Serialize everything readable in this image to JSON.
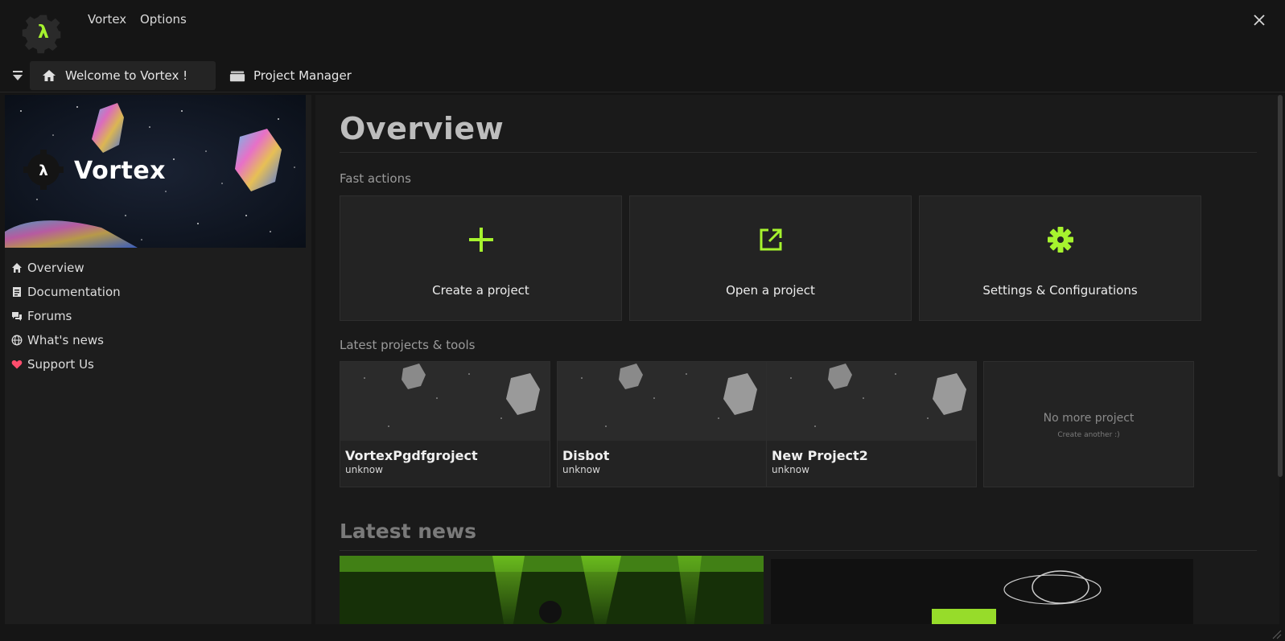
{
  "app": {
    "menu": [
      "Vortex",
      "Options"
    ],
    "logo_icon": "lambda-gear-icon",
    "accent": "#a6f32e"
  },
  "tabs": [
    {
      "label": "Welcome to Vortex !",
      "icon": "home-icon",
      "active": true
    },
    {
      "label": "Project Manager",
      "icon": "stack-icon",
      "active": false
    }
  ],
  "sidebar": {
    "banner_title": "Vortex",
    "items": [
      {
        "label": "Overview",
        "icon": "home-icon"
      },
      {
        "label": "Documentation",
        "icon": "document-icon"
      },
      {
        "label": "Forums",
        "icon": "chat-icon"
      },
      {
        "label": "What's news",
        "icon": "globe-icon"
      },
      {
        "label": "Support Us",
        "icon": "heart-icon",
        "icon_color": "#ff4d6d"
      }
    ]
  },
  "main": {
    "title": "Overview",
    "fast_actions_label": "Fast actions",
    "fast_actions": [
      {
        "label": "Create a project",
        "icon": "plus-icon"
      },
      {
        "label": "Open a project",
        "icon": "external-link-icon"
      },
      {
        "label": "Settings & Configurations",
        "icon": "gear-icon"
      }
    ],
    "latest_label": "Latest projects & tools",
    "projects": [
      {
        "name": "VortexPgdfgroject",
        "author": "unknow"
      },
      {
        "name": "Disbot",
        "author": "unknow"
      },
      {
        "name": "New Project2",
        "author": "unknow"
      }
    ],
    "empty": {
      "title": "No more project",
      "subtitle": "Create another :)"
    },
    "news_title": "Latest news"
  }
}
